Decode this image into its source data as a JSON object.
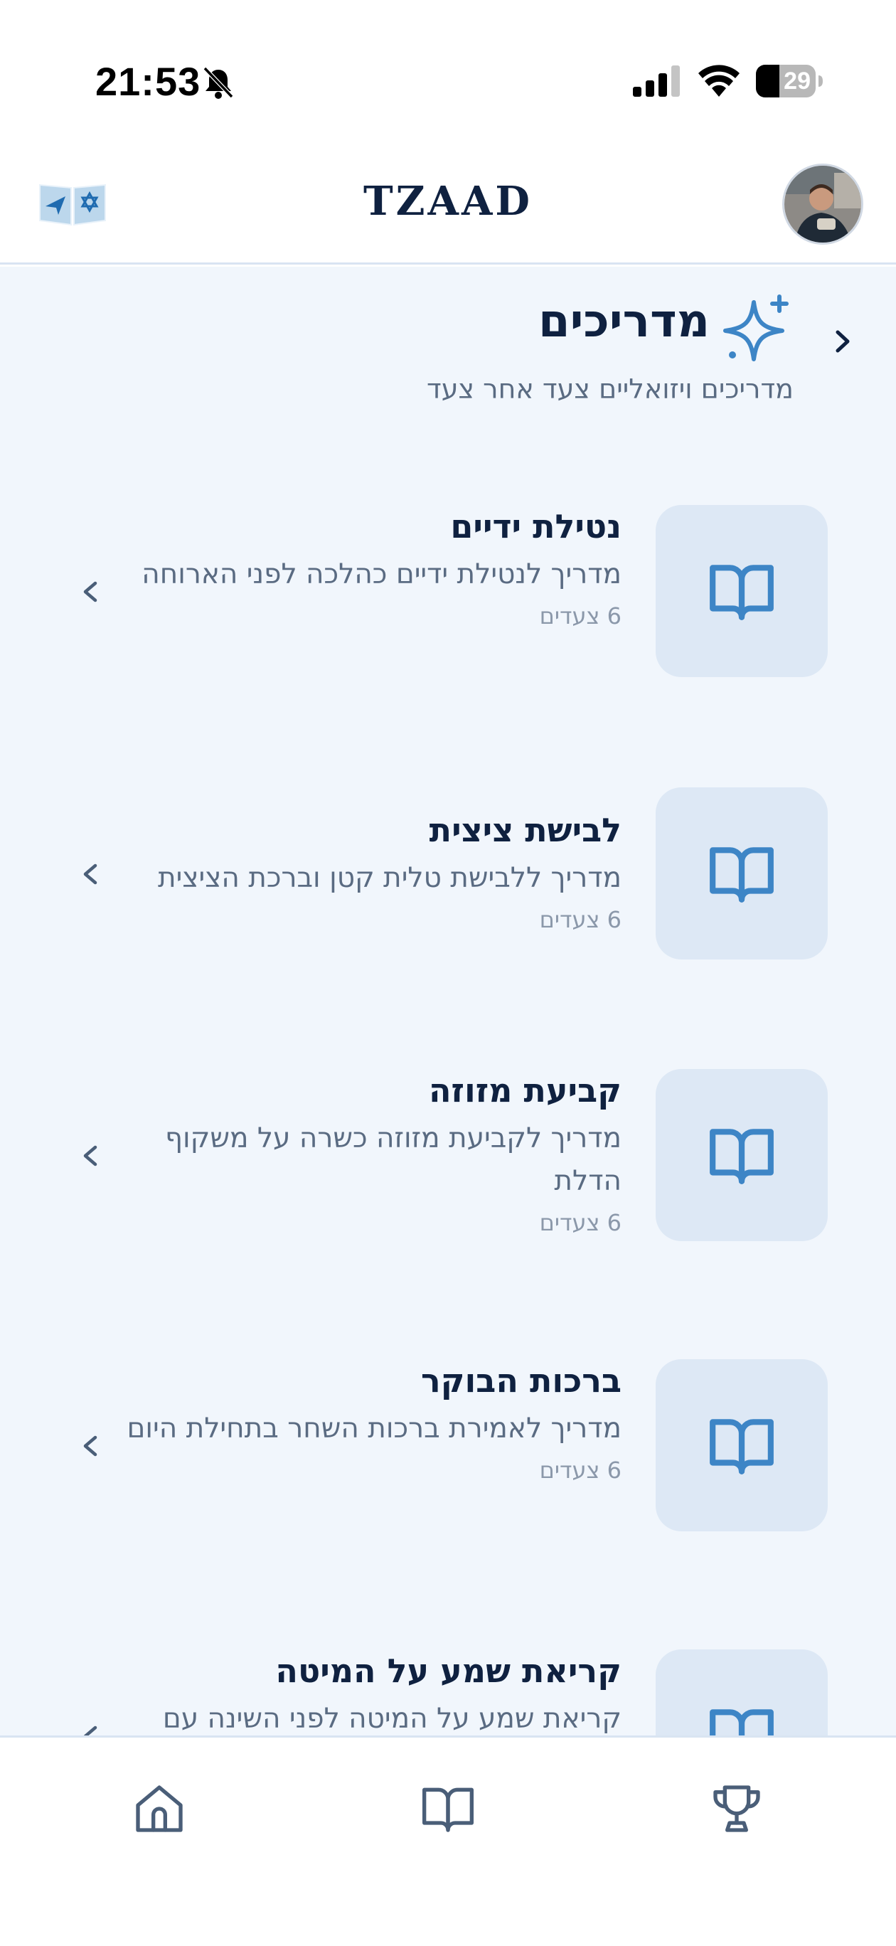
{
  "status_bar": {
    "time": "21:53",
    "battery_level": "29",
    "icons": [
      "bell-off-icon",
      "cellular-signal-icon",
      "wifi-icon",
      "battery-icon"
    ]
  },
  "header": {
    "title": "TZAAD",
    "logo_icon": "book-with-star-logo",
    "avatar": "user-avatar"
  },
  "section": {
    "title": "מדריכים",
    "subtitle": "מדריכים ויזואליים צעד אחר צעד",
    "icon": "sparkle-icon"
  },
  "guides": [
    {
      "title": "נטילת ידיים",
      "description": "מדריך לנטילת ידיים כהלכה לפני הארוחה",
      "steps": "6 צעדים"
    },
    {
      "title": "לבישת ציצית",
      "description": "מדריך ללבישת טלית קטן וברכת הציצית",
      "steps": "6 צעדים"
    },
    {
      "title": "קביעת מזוזה",
      "description": "מדריך לקביעת מזוזה כשרה על משקוף הדלת",
      "steps": "6 צעדים"
    },
    {
      "title": "ברכות הבוקר",
      "description": "מדריך לאמירת ברכות השחר בתחילת היום",
      "steps": "6 צעדים"
    },
    {
      "title": "קריאת שמע על המיטה",
      "description": "קריאת שמע על המיטה לפני השינה עם",
      "steps": ""
    }
  ],
  "bottom_nav": {
    "items": [
      "home-icon",
      "book-icon",
      "trophy-icon"
    ]
  },
  "colors": {
    "accent": "#3d85c6",
    "title": "#0f2140",
    "muted": "#5a6b82",
    "background": "#f1f6fc",
    "thumb": "#dde8f5"
  }
}
